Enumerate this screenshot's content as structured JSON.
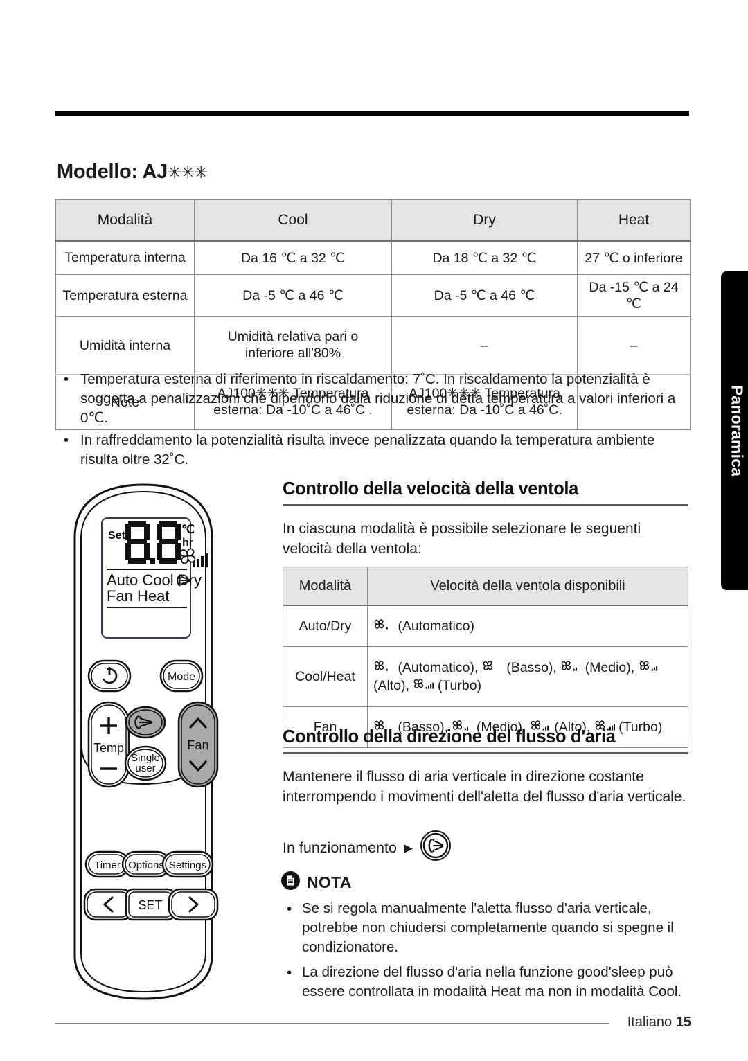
{
  "side_tab": {
    "label": "Panoramica"
  },
  "model": {
    "title": "Modello: AJ",
    "stars": "✳✳✳"
  },
  "spec_table": {
    "headers": [
      "Modalità",
      "Cool",
      "Dry",
      "Heat"
    ],
    "rows": [
      {
        "label": "Temperatura interna",
        "cool": "Da 16 ℃ a 32 ℃",
        "dry": "Da 18 ℃ a 32 ℃",
        "heat": "27 ℃ o inferiore"
      },
      {
        "label": "Temperatura esterna",
        "cool": "Da -5 ℃ a 46 ℃",
        "dry": "Da -5 ℃ a 46 ℃",
        "heat": "Da -15 ℃ a 24 ℃"
      },
      {
        "label": "Umidità interna",
        "cool_l1": "Umidità relativa pari o",
        "cool_l2": "inferiore all'80%",
        "dry": "–",
        "heat": "–"
      },
      {
        "label": "Note",
        "cool_l1": "AJ100✳✳✳ Temperatura",
        "cool_l2": "esterna: Da -10˚C a 46˚C .",
        "dry_l1": "AJ100✳✳✳ Temperatura",
        "dry_l2": "esterna: Da -10˚C a 46˚C.",
        "heat": ""
      }
    ]
  },
  "bullets": [
    "Temperatura esterna di riferimento in riscaldamento: 7˚C. In riscaldamento la potenzialità è soggetta a penalizzazioni che dipendono dalla riduzione di detta temperatura a valori inferiori a 0℃.",
    "In raffreddamento la potenzialità risulta invece penalizzata quando la temperatura ambiente risulta oltre 32˚C."
  ],
  "fan_section": {
    "heading": "Controllo della velocità della ventola",
    "paragraph": "In ciascuna modalità è possibile selezionare le seguenti velocità della ventola:",
    "table_headers": [
      "Modalità",
      "Velocità della ventola disponibili"
    ],
    "rows": [
      {
        "mode": "Auto/Dry",
        "speeds": [
          {
            "icon": "fan-auto-icon",
            "level": 1,
            "label": "(Automatico)"
          }
        ]
      },
      {
        "mode": "Cool/Heat",
        "speeds": [
          {
            "icon": "fan-auto-icon",
            "level": 1,
            "label": "(Automatico),"
          },
          {
            "icon": "fan-low-icon",
            "level": 0,
            "label": "(Basso),"
          },
          {
            "icon": "fan-medium-icon",
            "level": 2,
            "label": "(Medio),"
          },
          {
            "icon": "fan-high-icon",
            "level": 3,
            "label": "(Alto),"
          },
          {
            "icon": "fan-turbo-icon",
            "level": 4,
            "label": "(Turbo)"
          }
        ]
      },
      {
        "mode": "Fan",
        "speeds": [
          {
            "icon": "fan-low-icon",
            "level": 0,
            "label": "(Basso),"
          },
          {
            "icon": "fan-medium-icon",
            "level": 2,
            "label": "(Medio),"
          },
          {
            "icon": "fan-high-icon",
            "level": 3,
            "label": "(Alto),"
          },
          {
            "icon": "fan-turbo-icon",
            "level": 4,
            "label": "(Turbo)"
          }
        ]
      }
    ]
  },
  "airflow_section": {
    "heading": "Controllo della direzione del flusso d'aria",
    "paragraph": "Mantenere il flusso di aria verticale in direzione costante interrompendo i movimenti dell'aletta del flusso d'aria verticale.",
    "operating_label": "In funzionamento",
    "arrow": "▶"
  },
  "note_box": {
    "title": "NOTA",
    "items": [
      "Se si regola manualmente l'aletta flusso d'aria verticale, potrebbe non chiudersi completamente quando si spegne il condizionatore.",
      "La direzione del flusso d'aria nella funzione good'sleep può essere controllata in modalità Heat ma non in modalità Cool."
    ]
  },
  "footer": {
    "language": "Italiano",
    "page": "15"
  },
  "remote": {
    "lcd": {
      "set_label": "Set",
      "digits": "8.8",
      "unit_c": "℃",
      "unit_hr": "hr",
      "modes_line1": [
        "Auto",
        "Cool",
        "Dry"
      ],
      "modes_line2": [
        "Fan",
        "Heat"
      ]
    },
    "buttons": [
      {
        "name": "power-button",
        "label": ""
      },
      {
        "name": "mode-button",
        "label": "Mode"
      },
      {
        "name": "temp-button",
        "label": "Temp",
        "plus": "+",
        "minus": "−"
      },
      {
        "name": "airflow-button",
        "label": ""
      },
      {
        "name": "single-user-button",
        "label_line1": "Single",
        "label_line2": "user"
      },
      {
        "name": "fan-button",
        "label": "Fan"
      },
      {
        "name": "timer-button",
        "label": "Timer"
      },
      {
        "name": "options-button",
        "label": "Options"
      },
      {
        "name": "settings-button",
        "label": "Settings"
      },
      {
        "name": "prev-button",
        "label": "‹"
      },
      {
        "name": "set-button",
        "label": "SET"
      },
      {
        "name": "next-button",
        "label": "›"
      }
    ]
  },
  "colors": {
    "header_fill": "#e4e4e4",
    "rule": "#5a5a5a",
    "tab": "#000000",
    "button_gray": "#a8a8a8"
  }
}
